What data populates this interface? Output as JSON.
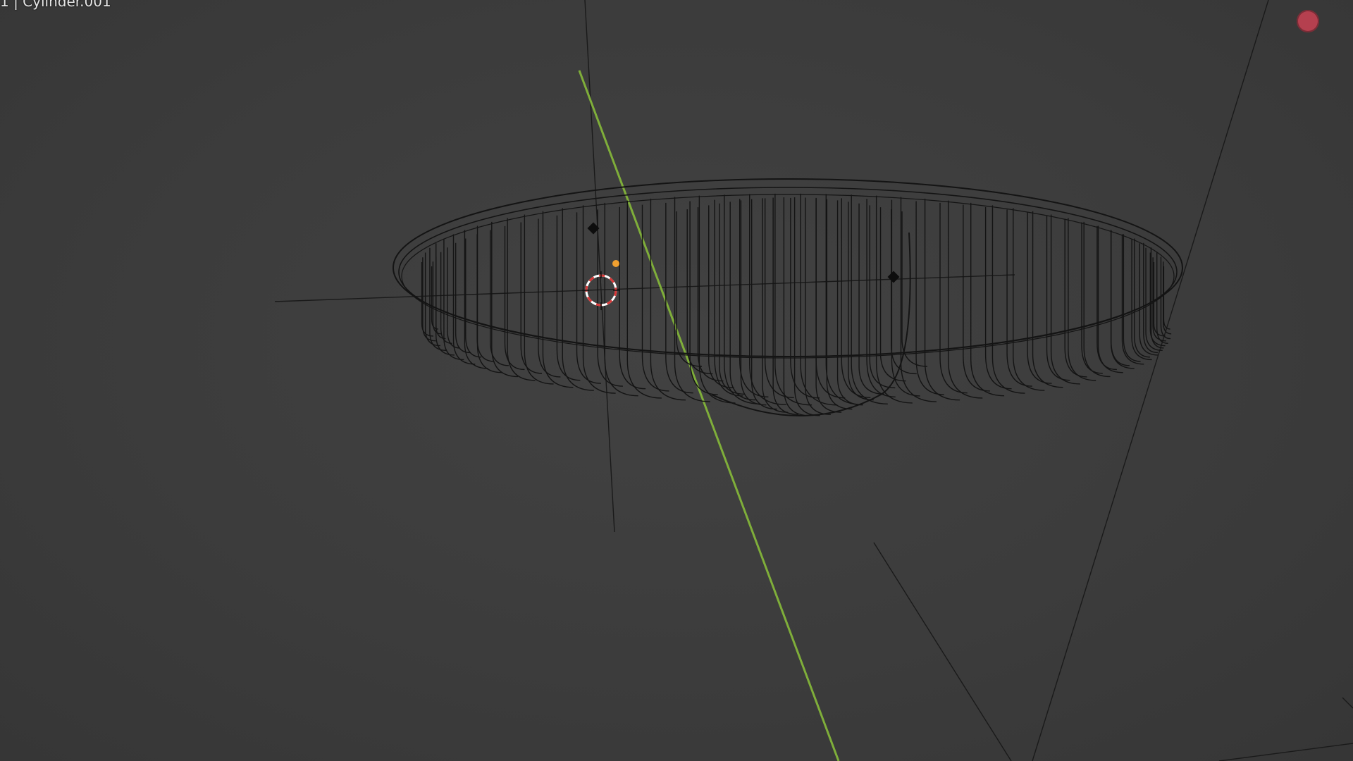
{
  "viewport": {
    "object_label": "1 | Cylinder.001"
  },
  "colors": {
    "background": "#3d3d3d",
    "wire": "#141414",
    "y_axis": "#7fae3a",
    "origin_dot": "#f0a030",
    "cursor_red": "#d83838",
    "cursor_white": "#ffffff",
    "record_indicator": "#b5404f"
  },
  "icons": {
    "cursor": "3d-cursor-icon",
    "origin": "object-origin-icon",
    "record": "record-indicator-icon"
  }
}
